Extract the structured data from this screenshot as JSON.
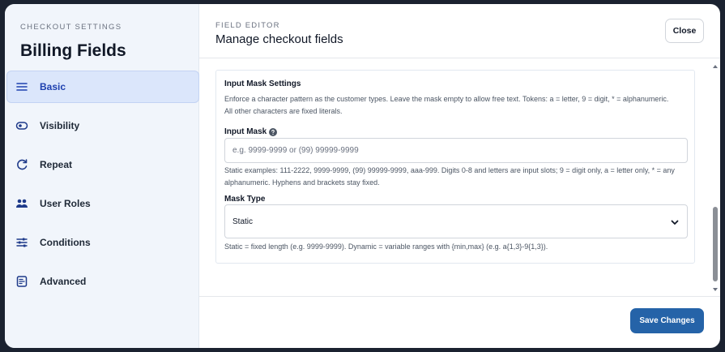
{
  "sidebar": {
    "kicker": "CHECKOUT SETTINGS",
    "title": "Billing Fields",
    "items": [
      {
        "label": "Basic",
        "icon": "menu-icon",
        "active": true
      },
      {
        "label": "Visibility",
        "icon": "eye-toggle-icon"
      },
      {
        "label": "Repeat",
        "icon": "refresh-icon"
      },
      {
        "label": "User Roles",
        "icon": "users-icon"
      },
      {
        "label": "Conditions",
        "icon": "sliders-icon"
      },
      {
        "label": "Advanced",
        "icon": "document-icon"
      }
    ]
  },
  "header": {
    "kicker": "FIELD EDITOR",
    "title": "Manage checkout fields",
    "close_label": "Close"
  },
  "section": {
    "title": "Input Mask Settings",
    "description": "Enforce a character pattern as the customer types. Leave the mask empty to allow free text. Tokens: a = letter, 9 = digit, * = alphanumeric. All other characters are fixed literals."
  },
  "input_mask": {
    "label": "Input Mask",
    "value": "",
    "placeholder": "e.g. 9999-9999 or (99) 99999-9999",
    "help": "Static examples: 111-2222, 9999-9999, (99) 99999-9999, aaa-999. Digits 0-8 and letters are input slots; 9 = digit only, a = letter only, * = any alphanumeric. Hyphens and brackets stay fixed."
  },
  "mask_type": {
    "label": "Mask Type",
    "value": "Static",
    "help": "Static = fixed length (e.g. 9999-9999). Dynamic = variable ranges with {min,max} (e.g. a{1,3}-9{1,3})."
  },
  "footer": {
    "save_label": "Save Changes"
  },
  "colors": {
    "accent": "#2563a8",
    "active_nav_bg": "#dbe6fb",
    "sidebar_bg": "#f1f5fb"
  }
}
